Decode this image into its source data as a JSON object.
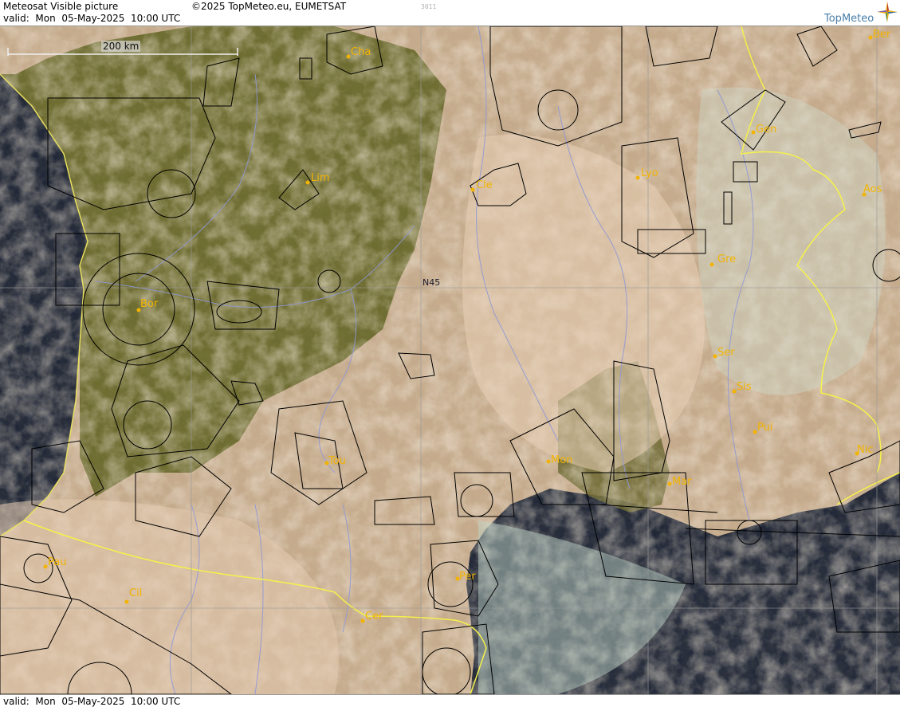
{
  "header": {
    "title": "Meteosat Visible picture",
    "copyright": "©2025 TopMeteo.eu, EUMETSAT",
    "valid": "valid:  Mon  05-May-2025  10:00 UTC",
    "code": "3011",
    "logo": "TopMeteo"
  },
  "footer": {
    "valid": "valid:  Mon  05-May-2025  10:00 UTC"
  },
  "map": {
    "scale_label": "200 km",
    "gridline_label": "N45",
    "cities": [
      {
        "id": "cha",
        "label": "Cha"
      },
      {
        "id": "lim",
        "label": "Lim"
      },
      {
        "id": "cle",
        "label": "Cle"
      },
      {
        "id": "lyo",
        "label": "Lyo"
      },
      {
        "id": "gen",
        "label": "Gen"
      },
      {
        "id": "ber",
        "label": "Ber"
      },
      {
        "id": "aos",
        "label": "Aos"
      },
      {
        "id": "gre",
        "label": "Gre"
      },
      {
        "id": "bor",
        "label": "Bor"
      },
      {
        "id": "ser",
        "label": "Ser"
      },
      {
        "id": "sis",
        "label": "Sis"
      },
      {
        "id": "pui",
        "label": "Pui"
      },
      {
        "id": "nic",
        "label": "Nic"
      },
      {
        "id": "tou",
        "label": "Tou"
      },
      {
        "id": "mon",
        "label": "Mon"
      },
      {
        "id": "mar",
        "label": "Mar"
      },
      {
        "id": "pau",
        "label": "Pau"
      },
      {
        "id": "cil",
        "label": "Cil"
      },
      {
        "id": "per",
        "label": "Per"
      },
      {
        "id": "cer",
        "label": "Cer"
      }
    ],
    "colors": {
      "sea": "#1a2133",
      "land_green": "#6e6a30",
      "cloud": "#e3c9ad",
      "border": "#f5f24a",
      "rivers": "#8f98d8",
      "airspace": "#000000",
      "city": "#f2b400"
    }
  }
}
